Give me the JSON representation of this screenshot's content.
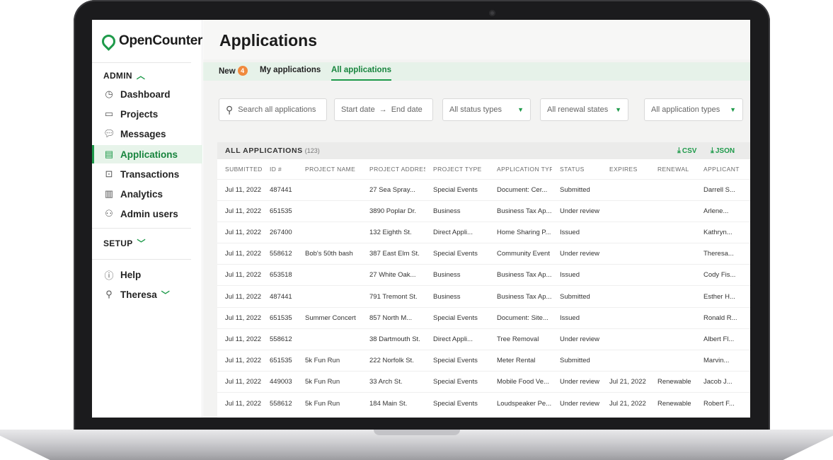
{
  "brand": {
    "name": "OpenCounter"
  },
  "sidebar": {
    "admin_section": "ADMIN",
    "admin_items": [
      {
        "label": "Dashboard",
        "icon": "dashboard-icon"
      },
      {
        "label": "Projects",
        "icon": "folder-icon"
      },
      {
        "label": "Messages",
        "icon": "messages-icon"
      },
      {
        "label": "Applications",
        "icon": "document-icon",
        "active": true
      },
      {
        "label": "Transactions",
        "icon": "dollar-icon"
      },
      {
        "label": "Analytics",
        "icon": "analytics-icon"
      },
      {
        "label": "Admin users",
        "icon": "users-icon"
      }
    ],
    "setup_section": "SETUP",
    "help_label": "Help",
    "user_label": "Theresa"
  },
  "header": {
    "title": "Applications"
  },
  "tabs": [
    {
      "label": "New",
      "badge": "4"
    },
    {
      "label": "My applications"
    },
    {
      "label": "All applications",
      "active": true
    }
  ],
  "filters": {
    "search_placeholder": "Search all applications",
    "start_date": "Start date",
    "date_arrow": "→",
    "end_date": "End date",
    "status": "All status types",
    "renewal": "All renewal states",
    "app_type": "All application types"
  },
  "table": {
    "title": "ALL APPLICATIONS",
    "count": "(123)",
    "export_csv": "CSV",
    "export_json": "JSON",
    "columns": [
      "SUBMITTED",
      "ID #",
      "PROJECT NAME",
      "PROJECT ADDRESS",
      "PROJECT TYPE",
      "APPLICATION TYPE",
      "STATUS",
      "EXPIRES",
      "RENEWAL",
      "APPLICANT"
    ],
    "rows": [
      [
        "Jul 11, 2022",
        "487441",
        "",
        "27 Sea Spray...",
        "Special Events",
        "Document: Cer...",
        "Submitted",
        "",
        "",
        "Darrell S..."
      ],
      [
        "Jul 11, 2022",
        "651535",
        "",
        "3890 Poplar Dr.",
        "Business",
        "Business Tax Ap...",
        "Under review",
        "",
        "",
        "Arlene..."
      ],
      [
        "Jul 11, 2022",
        "267400",
        "",
        "132 Eighth St.",
        "Direct Appli...",
        "Home Sharing P...",
        "Issued",
        "",
        "",
        "Kathryn..."
      ],
      [
        "Jul 11, 2022",
        "558612",
        "Bob's 50th bash",
        "387 East Elm St.",
        "Special Events",
        "Community Event",
        "Under review",
        "",
        "",
        "Theresa..."
      ],
      [
        "Jul 11, 2022",
        "653518",
        "",
        "27 White Oak...",
        "Business",
        "Business Tax Ap...",
        "Issued",
        "",
        "",
        "Cody Fis..."
      ],
      [
        "Jul 11, 2022",
        "487441",
        "",
        "791 Tremont St.",
        "Business",
        "Business Tax Ap...",
        "Submitted",
        "",
        "",
        "Esther H..."
      ],
      [
        "Jul 11, 2022",
        "651535",
        "Summer Concert",
        "857 North M...",
        "Special Events",
        "Document: Site...",
        "Issued",
        "",
        "",
        "Ronald R..."
      ],
      [
        "Jul 11, 2022",
        "558612",
        "",
        "38 Dartmouth St.",
        "Direct Appli...",
        "Tree Removal",
        "Under review",
        "",
        "",
        "Albert Fl..."
      ],
      [
        "Jul 11, 2022",
        "651535",
        "5k Fun Run",
        "222 Norfolk St.",
        "Special Events",
        "Meter Rental",
        "Submitted",
        "",
        "",
        "Marvin..."
      ],
      [
        "Jul 11, 2022",
        "449003",
        "5k Fun Run",
        "33 Arch St.",
        "Special Events",
        "Mobile Food Ve...",
        "Under review",
        "Jul 21, 2022",
        "Renewable",
        "Jacob J..."
      ],
      [
        "Jul 11, 2022",
        "558612",
        "5k Fun Run",
        "184 Main St.",
        "Special Events",
        "Loudspeaker Pe...",
        "Under review",
        "Jul 21, 2022",
        "Renewable",
        "Robert F..."
      ]
    ]
  },
  "colors": {
    "accent": "#1e9a4a",
    "badge": "#f08a3d",
    "tab_bar": "#e6f2e9"
  }
}
